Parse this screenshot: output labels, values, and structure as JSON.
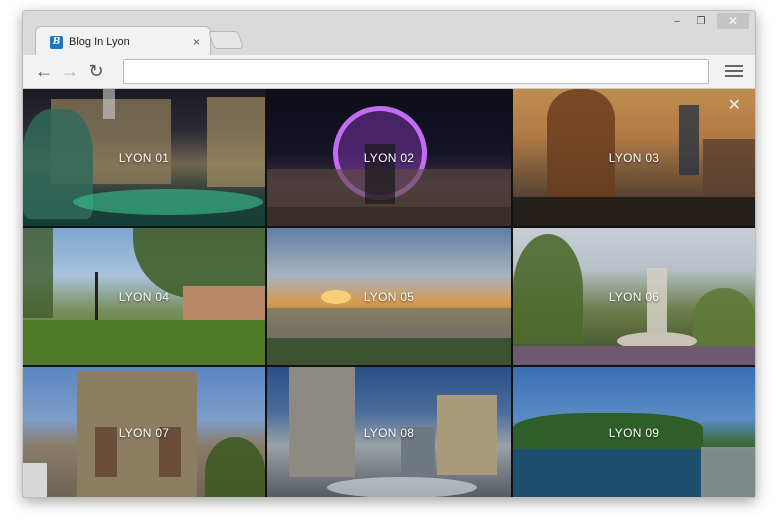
{
  "browser": {
    "tab": {
      "favicon_letter": "B",
      "title": "Blog In Lyon",
      "close_glyph": "×"
    },
    "window_controls": {
      "minimize": "–",
      "maximize": "❐",
      "close": "✕"
    },
    "toolbar": {
      "back_glyph": "←",
      "forward_glyph": "→",
      "reload_glyph": "↻",
      "url_value": "",
      "url_placeholder": ""
    }
  },
  "gallery": {
    "close_glyph": "✕",
    "tiles": [
      {
        "label": "LYON 01"
      },
      {
        "label": "LYON 02"
      },
      {
        "label": "LYON 03"
      },
      {
        "label": "LYON 04"
      },
      {
        "label": "LYON 05"
      },
      {
        "label": "LYON 06"
      },
      {
        "label": "LYON 07"
      },
      {
        "label": "LYON 08"
      },
      {
        "label": "LYON 09"
      }
    ]
  },
  "colors": {
    "favicon": "#1a78c2",
    "chrome_bg": "#dadada",
    "toolbar_bg": "#f2f2f2"
  }
}
